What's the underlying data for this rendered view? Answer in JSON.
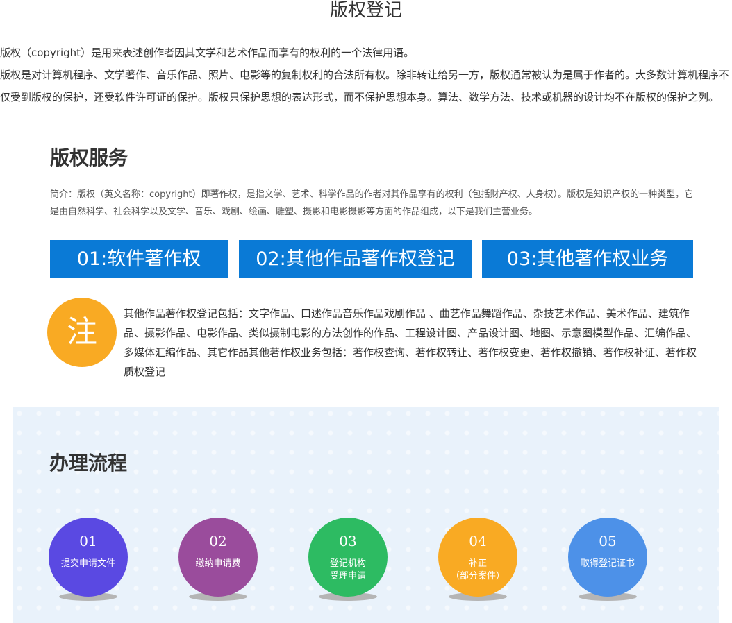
{
  "page_title": "版权登记",
  "intro": {
    "line1": "版权（copyright）是用来表述创作者因其文学和艺术作品而享有的权利的一个法律用语。",
    "line2": "版权是对计算机程序、文学著作、音乐作品、照片、电影等的复制权利的合法所有权。除非转让给另一方，版权通常被认为是属于作者的。大多数计算机程序不仅受到版权的保护，还受软件许可证的保护。版权只保护思想的表达形式，而不保护思想本身。算法、数学方法、技术或机器的设计均不在版权的保护之列。"
  },
  "services": {
    "heading": "版权服务",
    "description": "简介：版权（英文名称：copyright）即著作权，是指文学、艺术、科学作品的作者对其作品享有的权利（包括财产权、人身权）。版权是知识产权的一种类型，它是由自然科学、社会科学以及文学、音乐、戏剧、绘画、雕塑、摄影和电影摄影等方面的作品组成，以下是我们主营业务。",
    "tabs": [
      {
        "label": "01:软件著作权"
      },
      {
        "label": "02:其他作品著作权登记"
      },
      {
        "label": "03:其他著作权业务"
      }
    ],
    "tab_color": "#0a7ad6"
  },
  "note": {
    "badge": "注",
    "badge_color": "#f9aa23",
    "text": "其他作品著作权登记包括：文字作品、口述作品音乐作品戏剧作品 、曲艺作品舞蹈作品、杂技艺术作品、美术作品、建筑作品、摄影作品、电影作品、类似摄制电影的方法创作的作品、工程设计图、产品设计图、地图、示意图模型作品、汇编作品、 多媒体汇编作品、其它作品其他著作权业务包括：著作权查询、著作权转让、著作权变更、著作权撤销、著作权补证、著作权质权登记"
  },
  "process": {
    "heading": "办理流程",
    "steps": [
      {
        "num": "01",
        "label_line1": "提交申请文件",
        "label_line2": "",
        "color": "#5a49e2"
      },
      {
        "num": "02",
        "label_line1": "缴纳申请费",
        "label_line2": "",
        "color": "#9a4c9c"
      },
      {
        "num": "03",
        "label_line1": "登记机构",
        "label_line2": "受理申请",
        "color": "#2dbb62"
      },
      {
        "num": "04",
        "label_line1": "补正",
        "label_line2": "（部分案件）",
        "color": "#f9aa23"
      },
      {
        "num": "05",
        "label_line1": "取得登记证书",
        "label_line2": "",
        "color": "#4d91e8"
      }
    ]
  }
}
